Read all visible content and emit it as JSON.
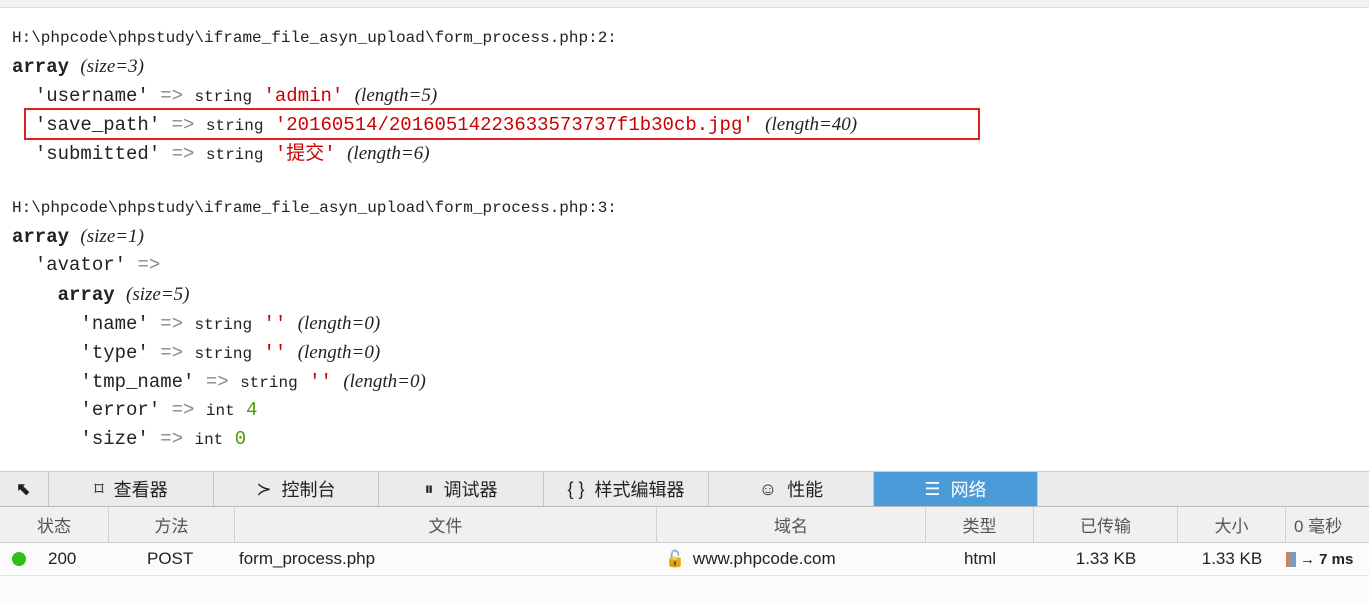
{
  "dump1": {
    "path": "H:\\phpcode\\phpstudy\\iframe_file_asyn_upload\\form_process.php:2:",
    "array": "array",
    "size": "(size=3)",
    "items": [
      {
        "key": "'username'",
        "type": "string",
        "value": "'admin'",
        "len": "(length=5)"
      },
      {
        "key": "'save_path'",
        "type": "string",
        "value": "'20160514/20160514223633573737f1b30cb.jpg'",
        "len": "(length=40)"
      },
      {
        "key": "'submitted'",
        "type": "string",
        "value": "'提交'",
        "len": "(length=6)"
      }
    ]
  },
  "dump2": {
    "path": "H:\\phpcode\\phpstudy\\iframe_file_asyn_upload\\form_process.php:3:",
    "array": "array",
    "size": "(size=1)",
    "key": "'avator'",
    "inner_array": "array",
    "inner_size": "(size=5)",
    "items": [
      {
        "key": "'name'",
        "type": "string",
        "value": "''",
        "len": "(length=0)"
      },
      {
        "key": "'type'",
        "type": "string",
        "value": "''",
        "len": "(length=0)"
      },
      {
        "key": "'tmp_name'",
        "type": "string",
        "value": "''",
        "len": "(length=0)"
      },
      {
        "key": "'error'",
        "type": "int",
        "value": "4"
      },
      {
        "key": "'size'",
        "type": "int",
        "value": "0"
      }
    ]
  },
  "arrow": "=>",
  "tabs": [
    "查看器",
    "控制台",
    "调试器",
    "样式编辑器",
    "性能",
    "网络"
  ],
  "columns": [
    "状态",
    "方法",
    "文件",
    "域名",
    "类型",
    "已传输",
    "大小",
    "0 毫秒"
  ],
  "request": {
    "status": "200",
    "method": "POST",
    "file": "form_process.php",
    "domain": "www.phpcode.com",
    "type": "html",
    "transferred": "1.33 KB",
    "size": "1.33 KB",
    "timing": "→ 7 ms"
  },
  "colors": {
    "active_tab": "#4a9bd8",
    "string": "#cc0000",
    "int": "#4e9a06",
    "status_ok": "#2fbf18",
    "highlight_box": "#e02020"
  }
}
